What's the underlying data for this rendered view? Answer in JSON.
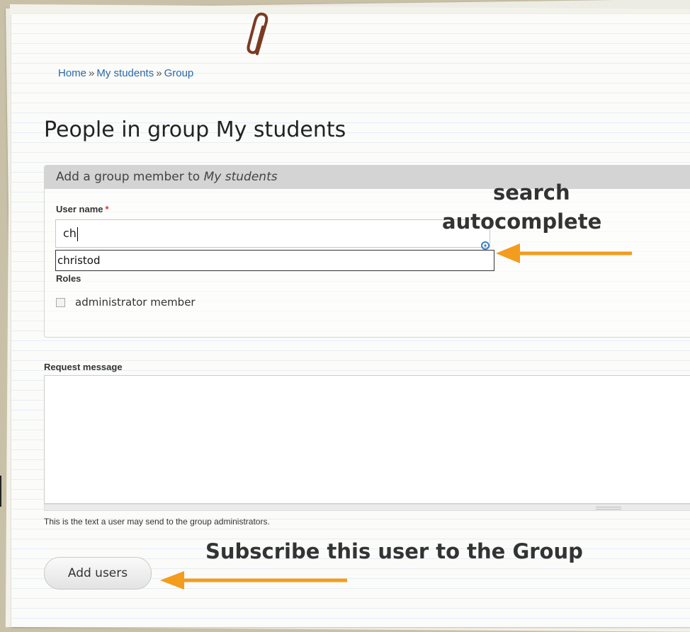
{
  "breadcrumb": {
    "items": [
      "Home",
      "My students",
      "Group"
    ],
    "separator": "»"
  },
  "page_title": "People in group My students",
  "add_member_box": {
    "legend_prefix": "Add a group member to",
    "legend_group": "My students",
    "username_label": "User name",
    "required_marker": "*",
    "username_value": "ch",
    "autocomplete_suggestion": "christod",
    "roles_label": "Roles",
    "role_option": "administrator member"
  },
  "request": {
    "label": "Request message",
    "value": "",
    "help_text": "This is the text a user may send to the group administrators."
  },
  "add_button_label": "Add users",
  "annotations": {
    "autocomplete_line1": "search",
    "autocomplete_line2": "autocomplete",
    "subscribe": "Subscribe this user to the Group"
  },
  "colors": {
    "link": "#2b6aa7",
    "annotation_arrow": "#f39c1e",
    "legend_bg": "#d4d4d4",
    "paperclip": "#7a3b22"
  },
  "icons": [
    "paperclip-icon",
    "throbber-icon",
    "arrow-left-icon"
  ]
}
